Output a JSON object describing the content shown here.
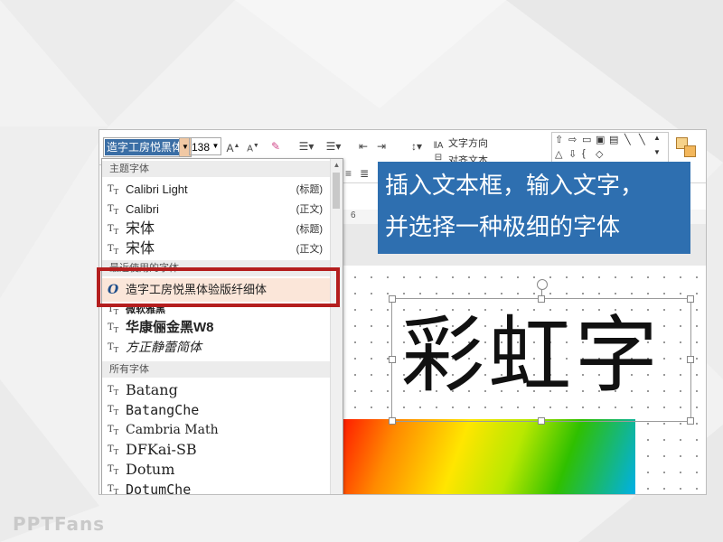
{
  "watermark": "PPTFans",
  "ribbon": {
    "font_name": "造字工房悦黑体",
    "font_size": "138",
    "grow_font": "A",
    "shrink_font": "A",
    "text_direction": "文字方向",
    "align_text": "对齐文本",
    "ruler_mark": "6"
  },
  "dropdown": {
    "theme_header": "主题字体",
    "theme_fonts": [
      {
        "name": "Calibri Light",
        "tag": "(标题)"
      },
      {
        "name": "Calibri",
        "tag": "(正文)"
      },
      {
        "name": "宋体",
        "tag": "(标题)"
      },
      {
        "name": "宋体",
        "tag": "(正文)"
      }
    ],
    "recent_header": "最近使用的字体",
    "recent_fonts": [
      {
        "name": "造字工房悦黑体验版纤细体",
        "icon": "O"
      },
      {
        "name": "微软雅黑"
      },
      {
        "name": "华康俪金黑W8"
      },
      {
        "name": "方正静蕾简体"
      }
    ],
    "all_header": "所有字体",
    "all_fonts": [
      "Batang",
      "BatangChe",
      "Cambria Math",
      "DFKai-SB",
      "Dotum",
      "DotumChe"
    ],
    "item_icon": "T"
  },
  "slide": {
    "text": "彩虹字"
  },
  "callout": {
    "line1": "插入文本框，输入文字，",
    "line2": "并选择一种极细的字体"
  },
  "colors": {
    "callout_bg": "#2e6fb0",
    "highlight_box": "#b41e1e",
    "hover_row": "#fbe6d9"
  }
}
